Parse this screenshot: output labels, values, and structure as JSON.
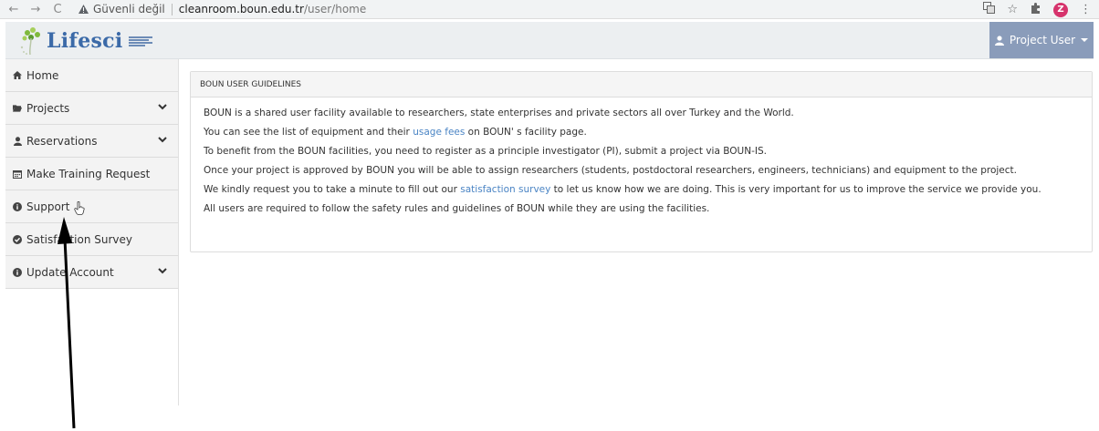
{
  "browser": {
    "back": "←",
    "forward": "→",
    "reload": "C",
    "security_label": "Güvenli değil",
    "url_host": "cleanroom.boun.edu.tr",
    "url_path": "/user/home",
    "profile_initial": "Z"
  },
  "header": {
    "logo_text": "Lifesci",
    "user_menu_label": "Project User"
  },
  "sidebar": {
    "items": [
      {
        "label": "Home",
        "icon": "home-icon",
        "has_chevron": false
      },
      {
        "label": "Projects",
        "icon": "folder-icon",
        "has_chevron": true
      },
      {
        "label": "Reservations",
        "icon": "user-icon",
        "has_chevron": true
      },
      {
        "label": "Make Training Request",
        "icon": "calendar-icon",
        "has_chevron": false
      },
      {
        "label": "Support",
        "icon": "info-icon",
        "has_chevron": false
      },
      {
        "label": "Satisfaction Survey",
        "icon": "check-circle-icon",
        "has_chevron": false
      },
      {
        "label": "Update Account",
        "icon": "info-icon",
        "has_chevron": true
      }
    ]
  },
  "panel": {
    "title": "BOUN USER GUIDELINES",
    "lines": {
      "l1": "BOUN is a shared user facility available to researchers, state enterprises and private sectors all over Turkey and the World.",
      "l2_before": "You can see the list of equipment and their ",
      "l2_link": "usage fees",
      "l2_after": " on BOUN' s facility page.",
      "l3": "To benefit from the BOUN facilities, you need to register as a principle investigator (PI), submit a project via BOUN-IS.",
      "l4": "Once your project is approved by BOUN you will be able to assign researchers (students, postdoctoral researchers, engineers, technicians) and equipment to the project.",
      "l5_before": "We kindly request you to take a minute to fill out our ",
      "l5_link": "satisfaction survey",
      "l5_after": " to let us know how we are doing. This is very important for us to improve the service we provide you.",
      "l6": "All users are required to follow the safety rules and guidelines of BOUN while they are using the facilities."
    }
  },
  "colors": {
    "user_button_bg": "#8a9cba",
    "link": "#4a84c4",
    "logo": "#3b6aa8"
  }
}
